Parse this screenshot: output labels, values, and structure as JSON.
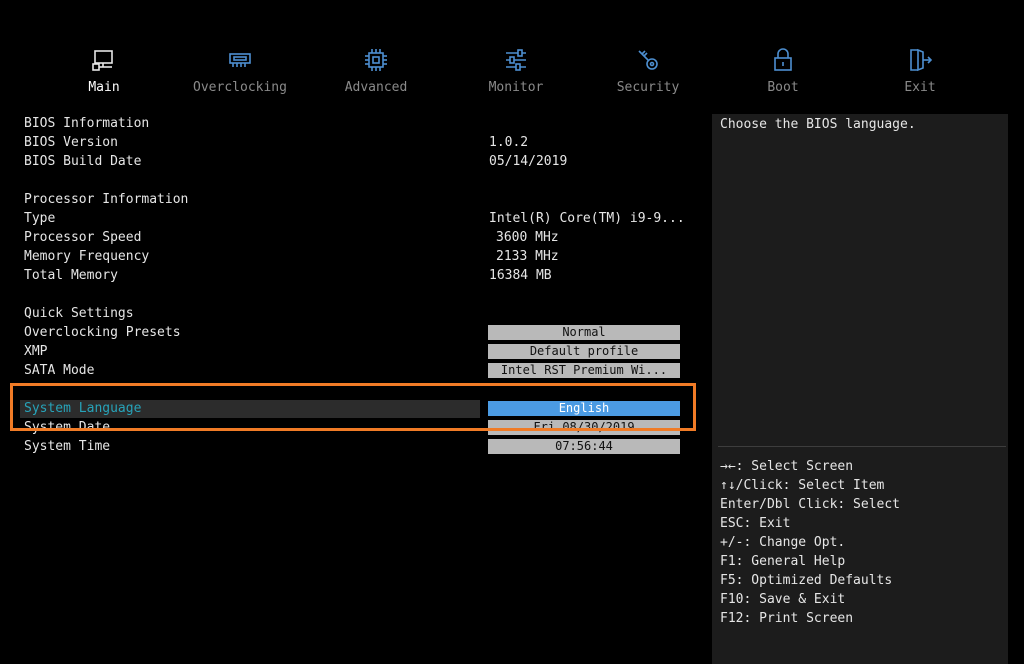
{
  "tabs": [
    {
      "label": "Main",
      "icon": "computer-icon",
      "active": true
    },
    {
      "label": "Overclocking",
      "icon": "memory-icon",
      "active": false
    },
    {
      "label": "Advanced",
      "icon": "chip-icon",
      "active": false
    },
    {
      "label": "Monitor",
      "icon": "sliders-icon",
      "active": false
    },
    {
      "label": "Security",
      "icon": "key-icon",
      "active": false
    },
    {
      "label": "Boot",
      "icon": "lock-icon",
      "active": false
    },
    {
      "label": "Exit",
      "icon": "exit-icon",
      "active": false
    }
  ],
  "bios": {
    "header": "BIOS Information",
    "version_label": "BIOS Version",
    "version_value": "1.0.2",
    "build_label": "BIOS Build Date",
    "build_value": "05/14/2019"
  },
  "processor": {
    "header": "Processor Information",
    "type_label": "Type",
    "type_value": "Intel(R) Core(TM) i9-9...",
    "speed_label": "Processor Speed",
    "speed_value": "3600 MHz",
    "mem_freq_label": "Memory Frequency",
    "mem_freq_value": "2133 MHz",
    "total_mem_label": "Total Memory",
    "total_mem_value": "16384 MB"
  },
  "quick": {
    "header": "Quick Settings",
    "oc_label": "Overclocking Presets",
    "oc_value": "Normal",
    "xmp_label": "XMP",
    "xmp_value": "Default profile",
    "sata_label": "SATA Mode",
    "sata_value": "Intel RST Premium Wi..."
  },
  "system": {
    "language_label": "System Language",
    "language_value": "English",
    "date_label": "System Date",
    "date_value": "Fri 08/30/2019",
    "time_label": "System Time",
    "time_value": "07:56:44"
  },
  "help_text": "Choose the BIOS language.",
  "keys": [
    "→←: Select Screen",
    "↑↓/Click: Select Item",
    "Enter/Dbl Click: Select",
    "ESC: Exit",
    "+/-: Change Opt.",
    "F1: General Help",
    "F5: Optimized Defaults",
    "F10: Save & Exit",
    "F12: Print Screen"
  ],
  "colors": {
    "background": "#000000",
    "panel": "#1c1c1c",
    "icon_blue": "#4d8fd1",
    "selected_value": "#4b9be3",
    "selected_label": "#27a3b9",
    "highlight_frame": "#f07b26"
  }
}
